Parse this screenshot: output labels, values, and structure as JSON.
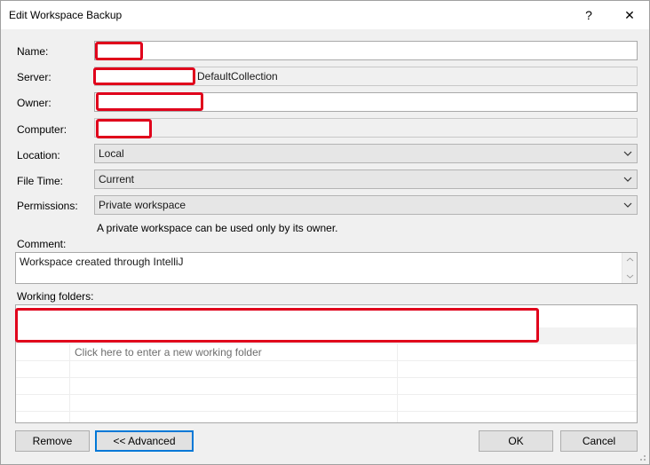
{
  "window": {
    "title": "Edit Workspace Backup",
    "help_glyph": "?",
    "close_glyph": "✕"
  },
  "form": {
    "name_label": "Name:",
    "server_label": "Server:",
    "server_value": "DefaultCollection",
    "owner_label": "Owner:",
    "computer_label": "Computer:",
    "location_label": "Location:",
    "location_value": "Local",
    "filetime_label": "File Time:",
    "filetime_value": "Current",
    "permissions_label": "Permissions:",
    "permissions_value": "Private workspace",
    "permissions_hint": "A private workspace can be used only by its owner.",
    "comment_label": "Comment:",
    "comment_value": "Workspace created through IntelliJ",
    "working_folders_label": "Working folders:",
    "new_folder_placeholder": "Click here to enter a new working folder"
  },
  "buttons": {
    "remove": "Remove",
    "advanced": "<< Advanced",
    "ok": "OK",
    "cancel": "Cancel"
  },
  "colors": {
    "redaction": "#e0001b",
    "focus": "#0078d7"
  }
}
